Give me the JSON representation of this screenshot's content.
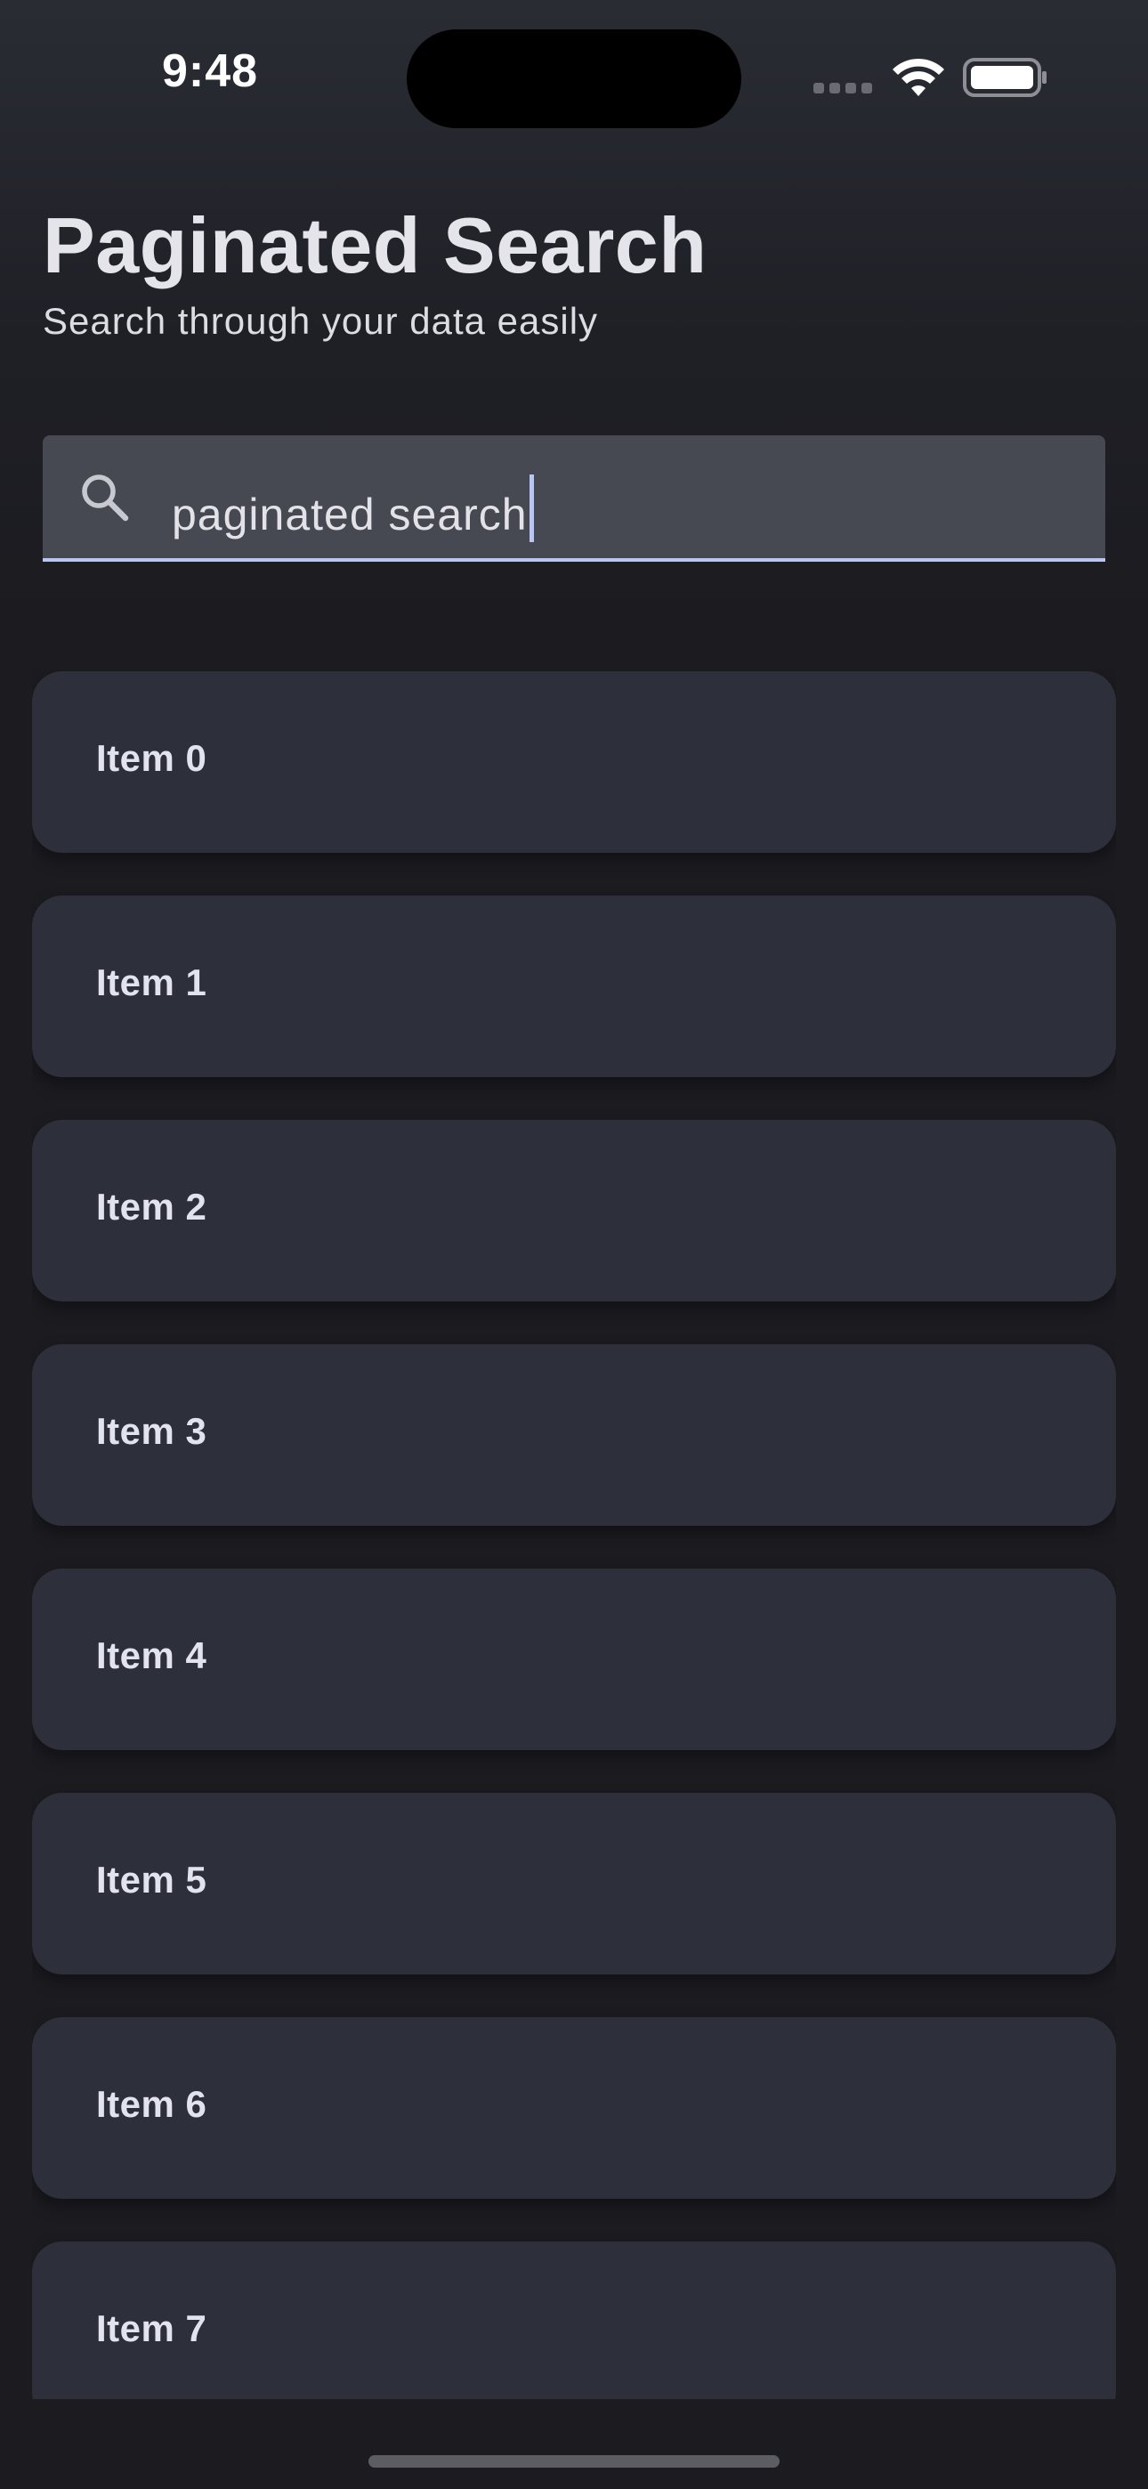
{
  "status_bar": {
    "time": "9:48",
    "icons": [
      "signal-icon",
      "wifi-icon",
      "battery-icon"
    ]
  },
  "header": {
    "title": "Paginated Search",
    "subtitle": "Search through your data easily"
  },
  "search": {
    "icon": "search-icon",
    "value": "paginated search",
    "accent_color": "#b9c6f2"
  },
  "results": {
    "items": [
      {
        "label": "Item 0"
      },
      {
        "label": "Item 1"
      },
      {
        "label": "Item 2"
      },
      {
        "label": "Item 3"
      },
      {
        "label": "Item 4"
      },
      {
        "label": "Item 5"
      },
      {
        "label": "Item 6"
      },
      {
        "label": "Item 7"
      }
    ]
  },
  "colors": {
    "background": "#1b1b20",
    "card": "#2d2f3a",
    "search_field": "#474952"
  }
}
